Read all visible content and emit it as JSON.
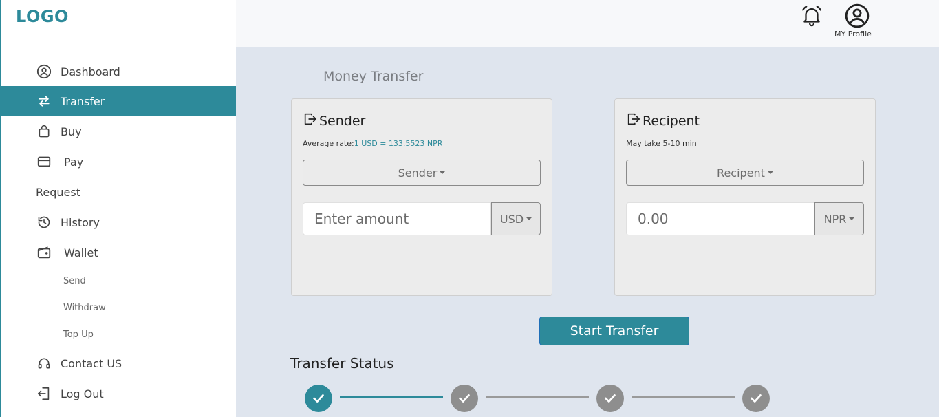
{
  "app": {
    "logo": "LOGO"
  },
  "sidebar": {
    "items": [
      {
        "label": "Dashboard",
        "icon": "user-circle-icon"
      },
      {
        "label": "Transfer",
        "icon": "transfer-arrows-icon",
        "active": true
      },
      {
        "label": "Buy",
        "icon": "shopping-bag-icon"
      },
      {
        "label": "Pay",
        "icon": "credit-card-icon"
      },
      {
        "label": "Request"
      },
      {
        "label": "History",
        "icon": "history-icon"
      },
      {
        "label": "Wallet",
        "icon": "wallet-icon"
      }
    ],
    "wallet_sub": [
      "Send",
      "Withdraw",
      "Top Up"
    ],
    "bottom": [
      {
        "label": "Contact US",
        "icon": "headset-icon"
      },
      {
        "label": "Log Out",
        "icon": "logout-icon"
      }
    ]
  },
  "header": {
    "profile_label": "MY Profile"
  },
  "main": {
    "title": "Money Transfer",
    "sender": {
      "title": "Sender",
      "note_prefix": "Average rate:",
      "rate": "1 USD = 133.5523 NPR",
      "dropdown": "Sender",
      "amount_placeholder": "Enter amount",
      "currency": "USD"
    },
    "recipient": {
      "title": "Recipent",
      "note": "May take 5-10 min",
      "dropdown": "Recipent",
      "amount": "0.00",
      "currency": "NPR"
    },
    "start_button": "Start Transfer",
    "status": {
      "title": "Transfer Status",
      "steps": [
        "done",
        "pending",
        "pending",
        "pending"
      ]
    }
  },
  "colors": {
    "accent": "#2d8a9a",
    "pending": "#8e8e8e",
    "page_bg": "#dfe5ee"
  }
}
